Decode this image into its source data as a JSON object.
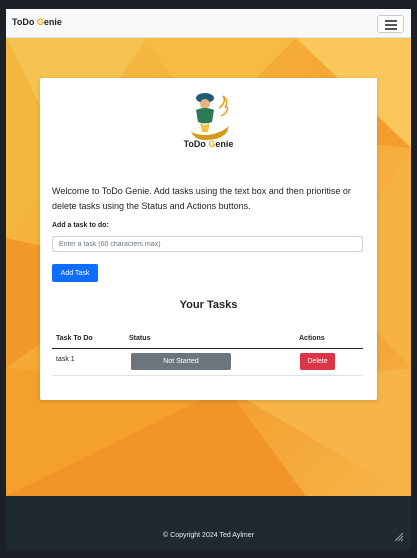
{
  "navbar": {
    "brand_prefix": "ToDo ",
    "brand_accent": "G",
    "brand_suffix": "enie",
    "menu_icon": "hamburger-icon"
  },
  "card": {
    "logo_icon": "genie-lamp-icon",
    "logo_prefix": "ToDo ",
    "logo_accent": "G",
    "logo_suffix": "enie",
    "intro": "Welcome to ToDo Genie. Add tasks using the text box and then prioritise or delete tasks using the Status and Actions buttons.",
    "input_label": "Add a task to do:",
    "input_placeholder": "Enter a task (60 characters max)",
    "input_value": "",
    "add_button": "Add Task",
    "section_title": "Your Tasks"
  },
  "table": {
    "headers": [
      "Task To Do",
      "Status",
      "Actions"
    ],
    "rows": [
      {
        "task": "task 1",
        "status": "Not Started",
        "action": "Delete"
      }
    ]
  },
  "footer": {
    "copyright": "© Copyright 2024 Ted Aylmer"
  },
  "colors": {
    "brand_accent": "#f0a81a",
    "primary": "#0d6efd",
    "danger": "#dc3545",
    "secondary": "#6c757d",
    "hero_orange": "#f5a834",
    "footer_bg": "#1e2a30"
  }
}
